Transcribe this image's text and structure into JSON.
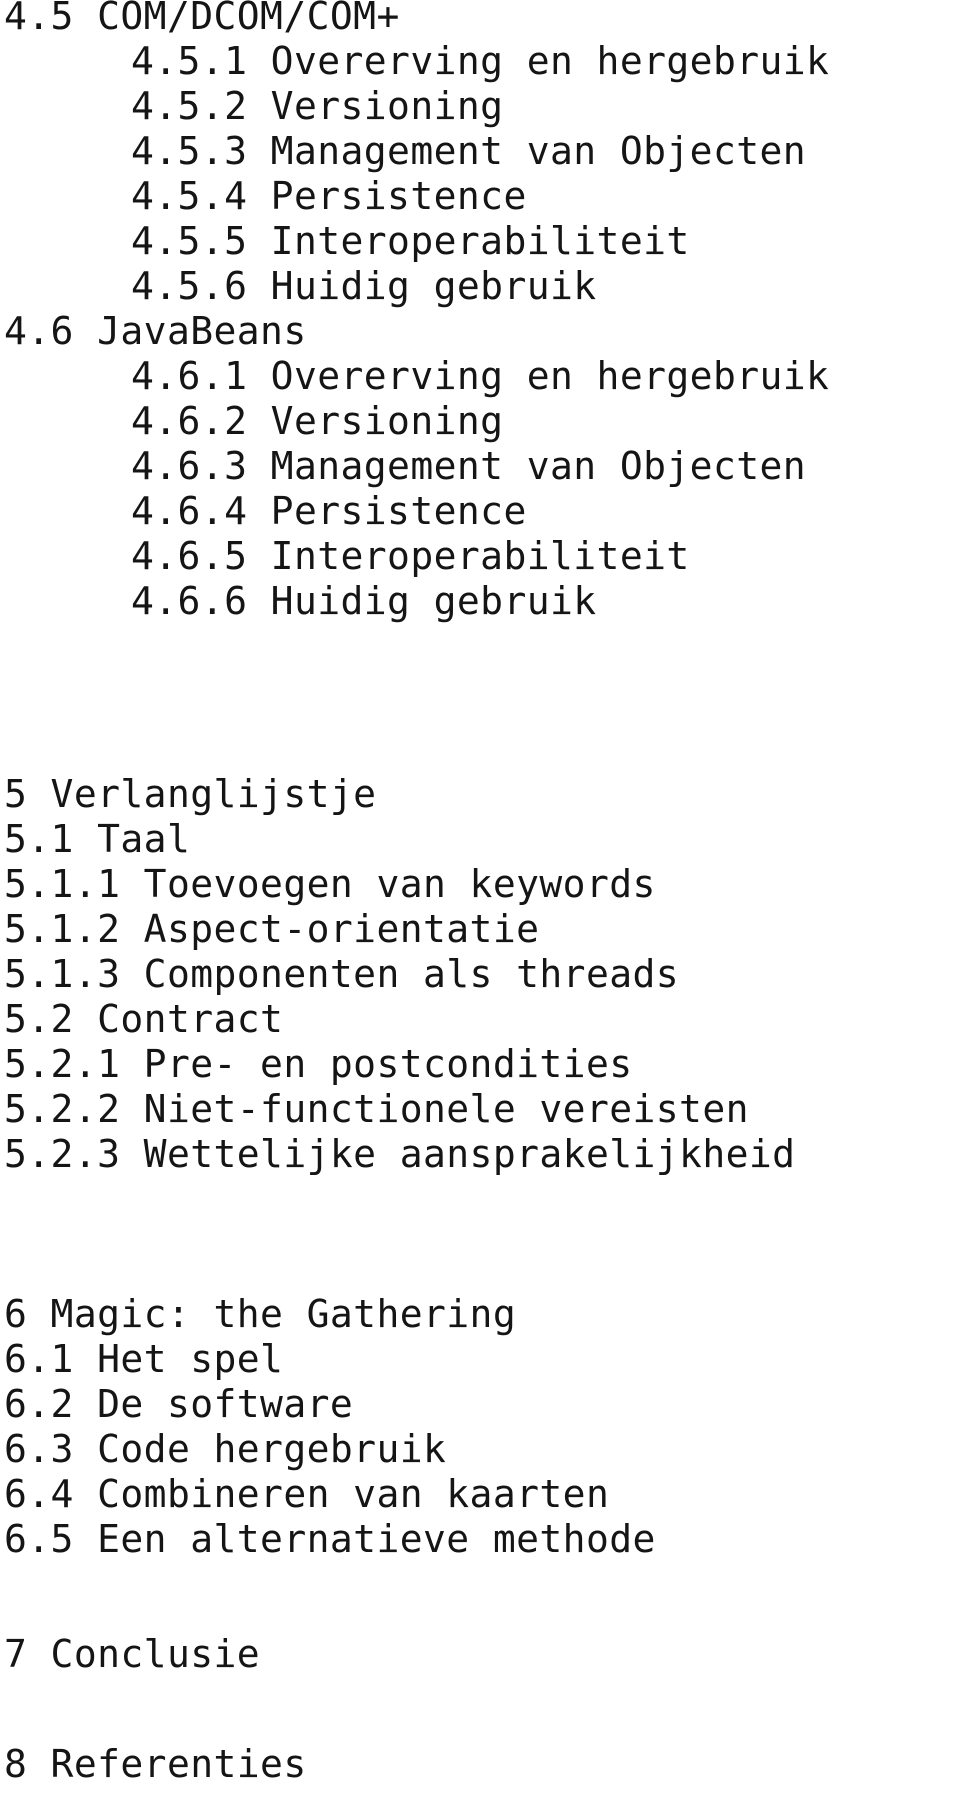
{
  "document": {
    "kind": "table-of-contents",
    "language": "nl",
    "background_color": "#ffffff",
    "text_color": "#151515"
  },
  "toc": {
    "blocks": [
      {
        "id": "chapter4",
        "entries": [
          {
            "number": "4.5",
            "title": "COM/DCOM/COM+",
            "level": 1,
            "text": "4.5 COM/DCOM/COM+"
          },
          {
            "number": "4.5.1",
            "title": "Overerving en hergebruik",
            "level": 2,
            "text": "4.5.1 Overerving en hergebruik"
          },
          {
            "number": "4.5.2",
            "title": "Versioning",
            "level": 2,
            "text": "4.5.2 Versioning"
          },
          {
            "number": "4.5.3",
            "title": "Management van Objecten",
            "level": 2,
            "text": "4.5.3 Management van Objecten"
          },
          {
            "number": "4.5.4",
            "title": "Persistence",
            "level": 2,
            "text": "4.5.4 Persistence"
          },
          {
            "number": "4.5.5",
            "title": "Interoperabiliteit",
            "level": 2,
            "text": "4.5.5 Interoperabiliteit"
          },
          {
            "number": "4.5.6",
            "title": "Huidig gebruik",
            "level": 2,
            "text": "4.5.6 Huidig gebruik"
          },
          {
            "number": "4.6",
            "title": "JavaBeans",
            "level": 1,
            "text": "4.6 JavaBeans"
          },
          {
            "number": "4.6.1",
            "title": "Overerving en hergebruik",
            "level": 2,
            "text": "4.6.1 Overerving en hergebruik"
          },
          {
            "number": "4.6.2",
            "title": "Versioning",
            "level": 2,
            "text": "4.6.2 Versioning"
          },
          {
            "number": "4.6.3",
            "title": "Management van Objecten",
            "level": 2,
            "text": "4.6.3 Management van Objecten"
          },
          {
            "number": "4.6.4",
            "title": "Persistence",
            "level": 2,
            "text": "4.6.4 Persistence"
          },
          {
            "number": "4.6.5",
            "title": "Interoperabiliteit",
            "level": 2,
            "text": "4.6.5 Interoperabiliteit"
          },
          {
            "number": "4.6.6",
            "title": "Huidig gebruik",
            "level": 2,
            "text": "4.6.6 Huidig gebruik"
          }
        ]
      },
      {
        "id": "chapter5",
        "entries": [
          {
            "number": "5",
            "title": "Verlanglijstje",
            "level": 1,
            "text": "5 Verlanglijstje"
          },
          {
            "number": "5.1",
            "title": "Taal",
            "level": 1,
            "text": "5.1 Taal"
          },
          {
            "number": "5.1.1",
            "title": "Toevoegen van keywords",
            "level": 1,
            "text": "5.1.1 Toevoegen van keywords"
          },
          {
            "number": "5.1.2",
            "title": "Aspect-orientatie",
            "level": 1,
            "text": "5.1.2 Aspect-orientatie"
          },
          {
            "number": "5.1.3",
            "title": "Componenten als threads",
            "level": 1,
            "text": "5.1.3 Componenten als threads"
          },
          {
            "number": "5.2",
            "title": "Contract",
            "level": 1,
            "text": "5.2 Contract"
          },
          {
            "number": "5.2.1",
            "title": "Pre- en postcondities",
            "level": 1,
            "text": "5.2.1 Pre- en postcondities"
          },
          {
            "number": "5.2.2",
            "title": "Niet-functionele vereisten",
            "level": 1,
            "text": "5.2.2 Niet-functionele vereisten"
          },
          {
            "number": "5.2.3",
            "title": "Wettelijke aansprakelijkheid",
            "level": 1,
            "text": "5.2.3 Wettelijke aansprakelijkheid"
          }
        ]
      },
      {
        "id": "chapter6",
        "entries": [
          {
            "number": "6",
            "title": "Magic: the Gathering",
            "level": 1,
            "text": "6 Magic: the Gathering"
          },
          {
            "number": "6.1",
            "title": "Het spel",
            "level": 1,
            "text": "6.1 Het spel"
          },
          {
            "number": "6.2",
            "title": "De software",
            "level": 1,
            "text": "6.2 De software"
          },
          {
            "number": "6.3",
            "title": "Code hergebruik",
            "level": 1,
            "text": "6.3 Code hergebruik"
          },
          {
            "number": "6.4",
            "title": "Combineren van kaarten",
            "level": 1,
            "text": "6.4 Combineren van kaarten"
          },
          {
            "number": "6.5",
            "title": "Een alternatieve methode",
            "level": 1,
            "text": "6.5 Een alternatieve methode"
          }
        ]
      },
      {
        "id": "chapter7",
        "entries": [
          {
            "number": "7",
            "title": "Conclusie",
            "level": 1,
            "text": "7 Conclusie"
          }
        ]
      },
      {
        "id": "chapter8",
        "entries": [
          {
            "number": "8",
            "title": "Referenties",
            "level": 1,
            "text": "8 Referenties"
          }
        ]
      }
    ]
  }
}
